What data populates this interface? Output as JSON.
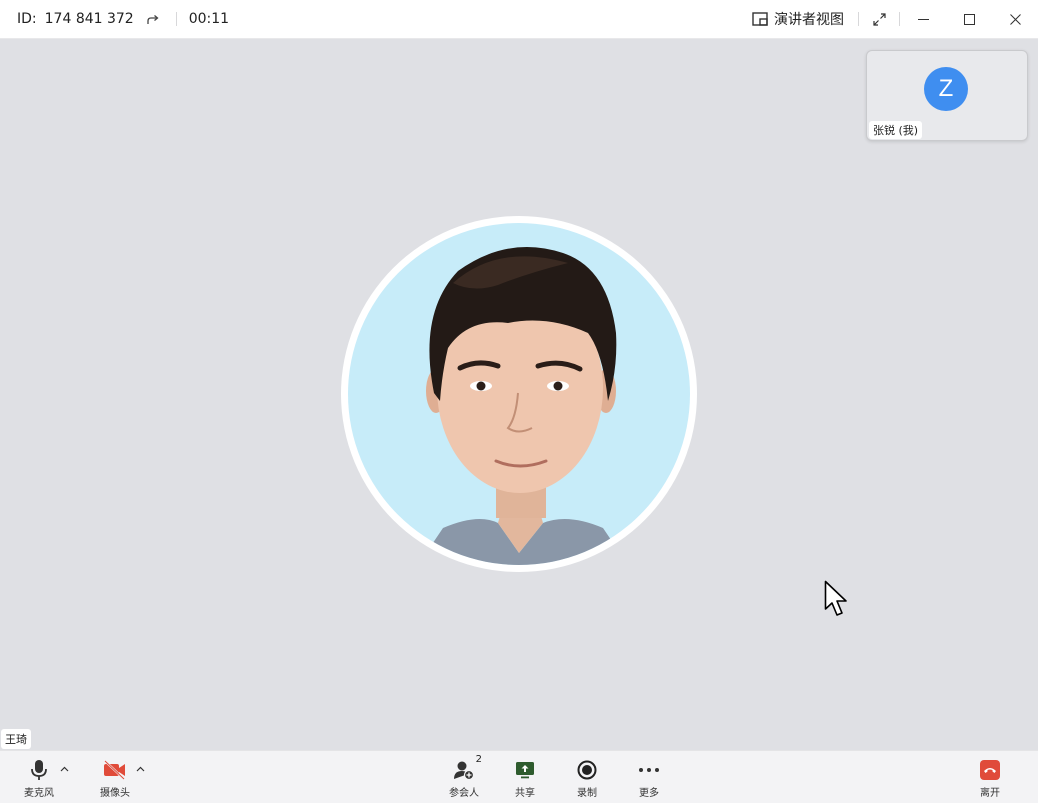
{
  "titlebar": {
    "id_label": "ID:",
    "meeting_id": "174 841 372",
    "timer": "00:11",
    "presenter_view": "演讲者视图"
  },
  "self_tile": {
    "initial": "Z",
    "name": "张锐 (我)",
    "avatar_color": "#3f8ef0"
  },
  "speaker": {
    "name": "王琦"
  },
  "toolbar": {
    "mic_label": "麦克风",
    "camera_label": "摄像头",
    "participants_label": "参会人",
    "participants_count": "2",
    "share_label": "共享",
    "record_label": "录制",
    "more_label": "更多",
    "leave_label": "离开"
  },
  "colors": {
    "background": "#dfe0e4",
    "camera_off": "#e04b3a",
    "share_green": "#2e5b2e",
    "leave_red": "#e04b3a"
  }
}
